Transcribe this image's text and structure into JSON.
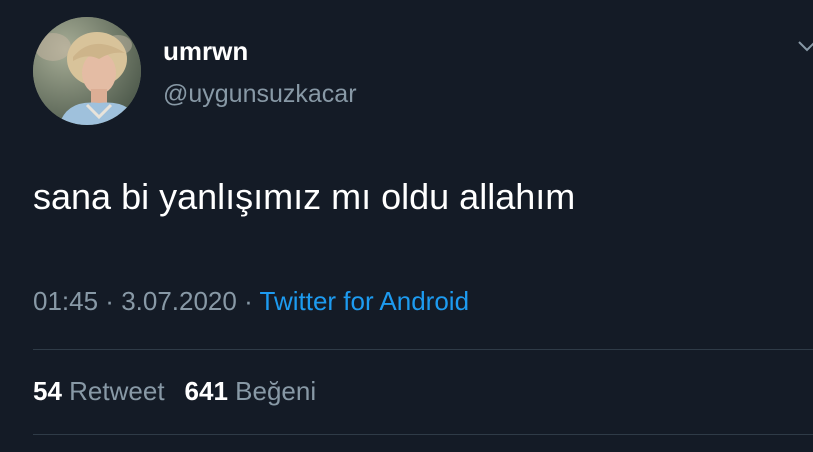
{
  "tweet": {
    "display_name": "umrwn",
    "handle": "@uygunsuzkacar",
    "text": "sana bi yanlışımız mı oldu allahım",
    "time": "01:45",
    "separator_1": " · ",
    "date": "3.07.2020",
    "separator_2": " · ",
    "source": "Twitter for Android"
  },
  "stats": {
    "retweets_count": "54",
    "retweets_label": "Retweet",
    "likes_count": "641",
    "likes_label": "Beğeni"
  },
  "icons": {
    "avatar": "profile-photo",
    "more": "chevron-down-icon"
  },
  "colors": {
    "background": "#141b26",
    "primary_text": "#ffffff",
    "secondary_text": "#8899a6",
    "link": "#1d9bf0",
    "divider": "#2f3b47"
  }
}
